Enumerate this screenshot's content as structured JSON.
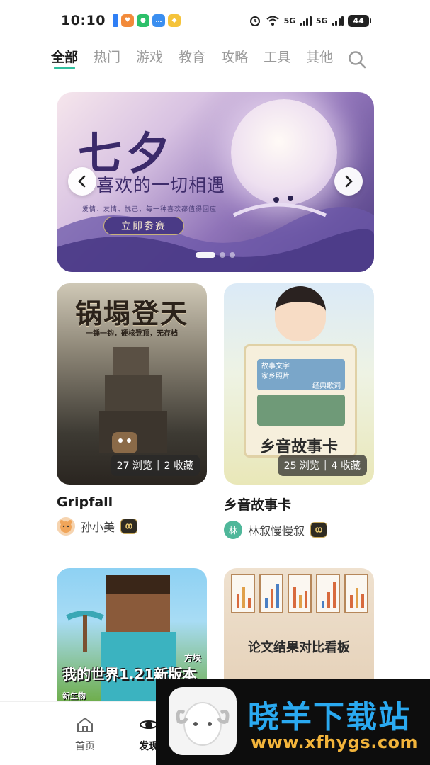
{
  "status_bar": {
    "time": "10:10",
    "network_1": "5G",
    "network_2": "5G",
    "battery": "44"
  },
  "tabs": [
    {
      "label": "全部",
      "active": true
    },
    {
      "label": "热门"
    },
    {
      "label": "游戏"
    },
    {
      "label": "教育"
    },
    {
      "label": "攻略"
    },
    {
      "label": "工具"
    },
    {
      "label": "其他"
    }
  ],
  "search_icon": "search-icon",
  "banner": {
    "title": "七夕",
    "subtitle": "喜欢的一切相遇",
    "small_text": "爱情、友情、悦己，每一种喜欢都值得回应",
    "cta": "立即参赛",
    "slide_count": 3,
    "active_slide": 1
  },
  "cards": [
    {
      "art_title": "锅塌登天",
      "art_tagline": "一锤一钩，硬核登顶，无存档",
      "views": "27 浏览",
      "favorites": "2 收藏",
      "title": "Gripfall",
      "author": "孙小美",
      "avatar_color": "#f0a55a"
    },
    {
      "art_title": "乡音故事卡",
      "board_items": [
        "故事文字",
        "家乡照片",
        "经典歌词"
      ],
      "views": "25 浏览",
      "favorites": "4 收藏",
      "title": "乡音故事卡",
      "author": "林叙慢慢叙",
      "avatar_letter": "林",
      "avatar_color": "#4fb79a"
    },
    {
      "art_title": "我的世界1.21新版本",
      "art_tag_1": "方块",
      "art_tag_2": "新生物"
    },
    {
      "art_title": "论文结果对比看板"
    }
  ],
  "bottom_nav": [
    {
      "label": "首页",
      "icon": "home-icon"
    },
    {
      "label": "发现",
      "icon": "discover-icon",
      "active": true
    }
  ],
  "watermark": {
    "title": "晓羊下载站",
    "url": "www.xfhygs.com"
  },
  "colors": {
    "accent": "#2fbf9e",
    "watermark_title": "#2aa9f0",
    "watermark_url": "#f2b43b"
  }
}
